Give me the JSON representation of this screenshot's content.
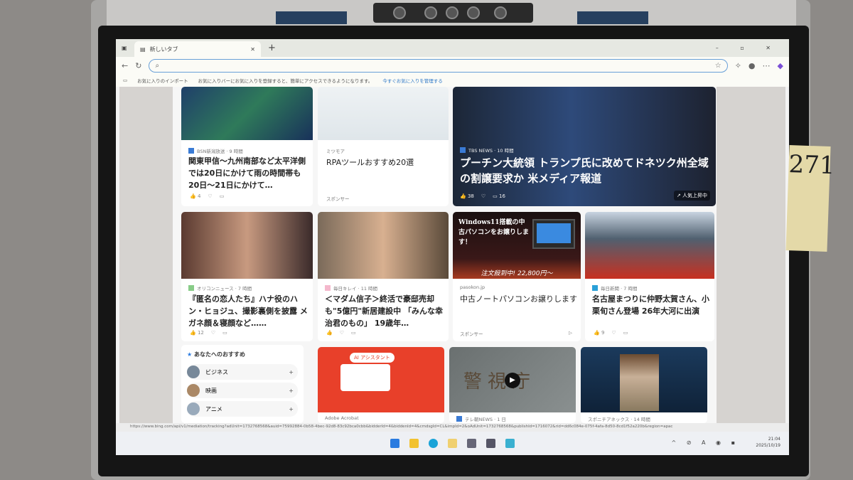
{
  "browser": {
    "tab_title": "新しいタブ",
    "address_placeholder": "",
    "favorites_import": "お気に入りのインポート",
    "favorites_hint": "お気に入りバーにお気に入りを登録すると、簡単にアクセスできるようになります。",
    "favorites_manage_link": "今すぐお気に入りを管理する"
  },
  "cards": [
    {
      "source": "BSN新潟放送 · 9 時間",
      "title": "関東甲信～九州南部など太平洋側では20日にかけて雨の時間帯も 20日～21日にかけて…",
      "likes": "4"
    },
    {
      "source": "ミツモア",
      "title": "RPAツールおすすめ20選",
      "sponsor": "スポンサー"
    },
    {
      "source": "TBS NEWS · 10 時間",
      "title": "プーチン大統領 トランプ氏に改めてドネツク州全域の割譲要求か 米メディア報道",
      "likes": "38",
      "comments": "16",
      "badge": "人気上昇中"
    },
    {
      "source": "オリコンニュース · 7 時間",
      "title": "『匿名の恋人たち』ハナ役のハン・ヒョジュ、撮影裏側を披露 メガネ顔＆寝顔など……",
      "likes": "12"
    },
    {
      "source": "毎日キレイ · 11 時間",
      "title": "＜マダム信子＞終活で豪邸売却も\"5億円\"新居建設中 「みんな幸治君のもの」 19歳年…"
    },
    {
      "source": "pasokon.jp",
      "title": "中古ノートパソコンお譲りします",
      "sponsor": "スポンサー",
      "ad_headline": "Windows11搭載の中古パソコンをお譲りします！",
      "ad_price": "注文殺到中! 22,800円～"
    },
    {
      "source": "毎日新聞 · 7 時間",
      "title": "名古屋まつりに仲野太賀さん、小栗旬さん登場 26年大河に出演",
      "likes": "9"
    },
    {
      "source": "Adobe Acrobat",
      "ad_badge": "AI アシスタント"
    },
    {
      "source": "テレ朝NEWS · 1 日",
      "image_text": "警視庁"
    },
    {
      "source": "スポニチアネックス · 14 時間"
    }
  ],
  "recommend": {
    "title": "あなたへのおすすめ",
    "items": [
      {
        "label": "ビジネス"
      },
      {
        "label": "映画"
      },
      {
        "label": "アニメ"
      }
    ]
  },
  "status_url": "https://www.bing.com/api/v1/mediation/tracking?adUnit=1732768568&auid=75992884-0b58-4bec-92d8-83c92bca0cbb&bidderId=4&biddenId=4&cmdsgId=CL&impId=2&oAdUnit=1732768568&publishId=1716072&rid=dd6c084e-075f-4afa-8d50-8cd1f52a220b&region=apac",
  "taskbar": {
    "time": "21:04",
    "date": "2025/10/19"
  },
  "tape_label": "271"
}
